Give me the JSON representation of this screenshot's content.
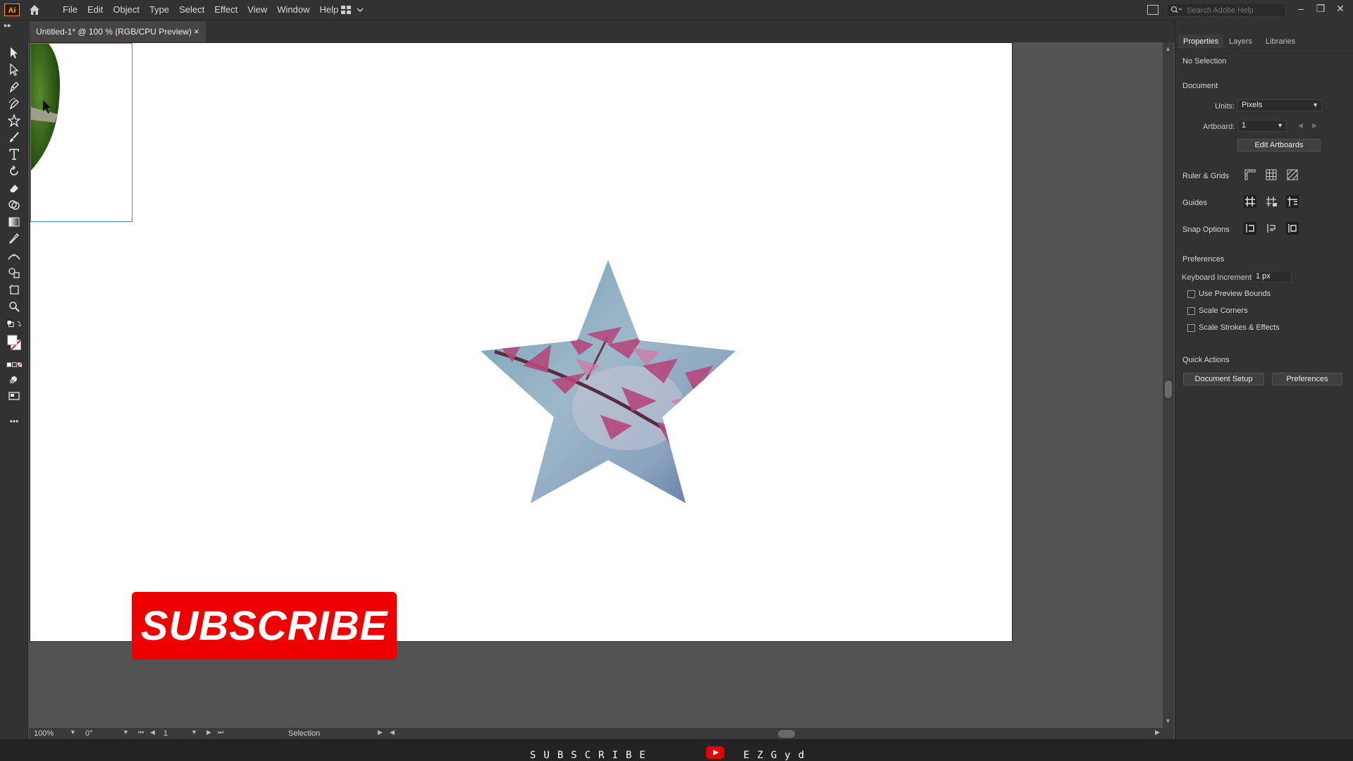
{
  "app": {
    "logo": "Ai",
    "menu": [
      "File",
      "Edit",
      "Object",
      "Type",
      "Select",
      "Effect",
      "View",
      "Window",
      "Help"
    ],
    "search_placeholder": "Search Adobe Help",
    "window_controls": [
      "–",
      "❐",
      "✕"
    ]
  },
  "document_tab": {
    "title": "Untitled-1* @ 100 % (RGB/CPU Preview)",
    "close": "×"
  },
  "toolbar": {
    "tools": [
      "selection-tool",
      "direct-selection-tool",
      "pen-tool",
      "curvature-tool",
      "star-tool",
      "paintbrush-tool",
      "type-tool",
      "rotate-tool",
      "eraser-tool",
      "shape-builder-tool",
      "gradient-tool",
      "eyedropper-tool",
      "width-tool",
      "symbol-sprayer-tool",
      "artboard-tool",
      "zoom-tool"
    ],
    "more": "•••"
  },
  "canvas": {
    "subscribe_label": "SUBSCRIBE",
    "colors": {
      "artboard": "#ffffff",
      "subscribe_bg": "#ee0000",
      "selection_outline": "#5b7fd0"
    }
  },
  "status_bar": {
    "zoom": "100%",
    "rotation": "0°",
    "artboard_number": "1",
    "current_tool": "Selection"
  },
  "properties_panel": {
    "tabs": [
      "Properties",
      "Layers",
      "Libraries"
    ],
    "active_tab": "Properties",
    "selection_state": "No Selection",
    "document_heading": "Document",
    "units_label": "Units:",
    "units_value": "Pixels",
    "artboard_label": "Artboard:",
    "artboard_value": "1",
    "edit_artboards": "Edit Artboards",
    "ruler_grids": "Ruler & Grids",
    "guides": "Guides",
    "snap_options": "Snap Options",
    "preferences_heading": "Preferences",
    "keyboard_increment_label": "Keyboard Increment:",
    "keyboard_increment_value": "1 px",
    "checkboxes": [
      "Use Preview Bounds",
      "Scale Corners",
      "Scale Strokes & Effects"
    ],
    "quick_actions": "Quick Actions",
    "document_setup": "Document Setup",
    "preferences_button": "Preferences"
  },
  "overlay": {
    "subscribe_left": "SUBSCRIBE",
    "subscribe_right": "EZGyd"
  }
}
